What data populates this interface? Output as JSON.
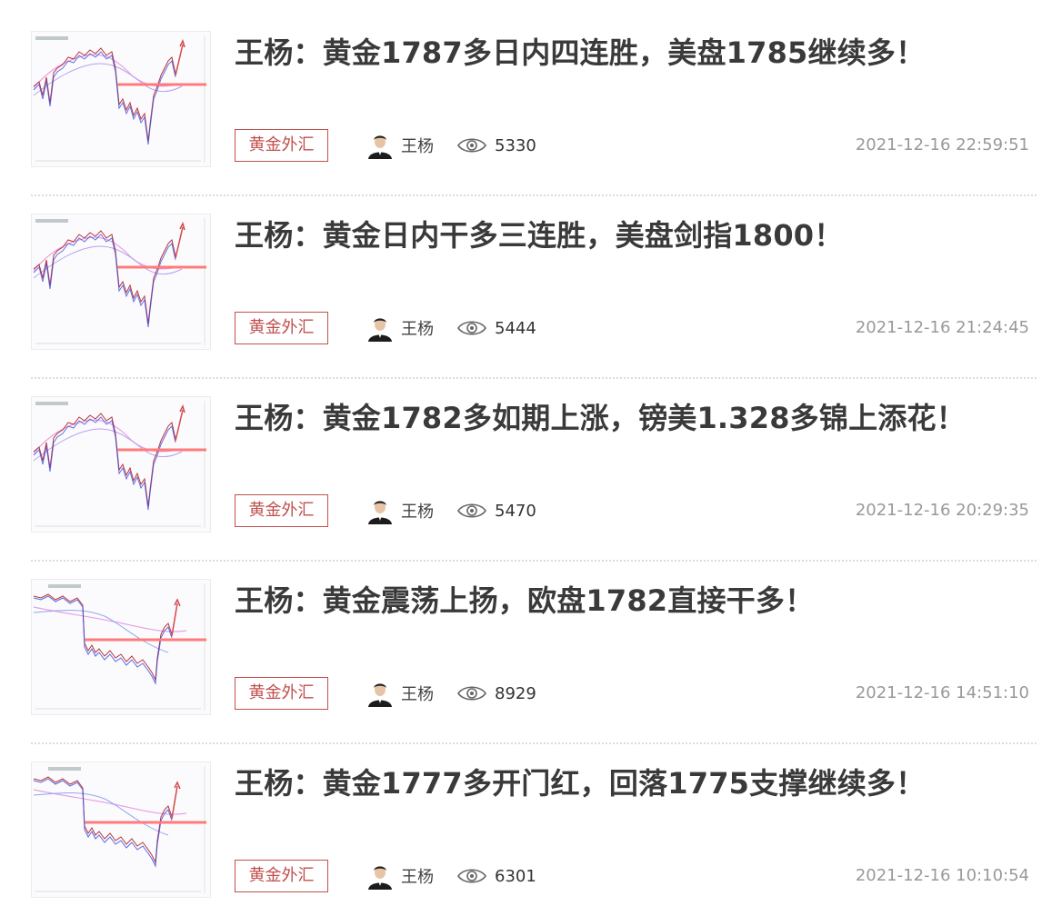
{
  "articles": [
    {
      "title": "王杨：黄金1787多日内四连胜，美盘1785继续多！",
      "tag": "黄金外汇",
      "author": "王杨",
      "views": "5330",
      "time": "2021-12-16 22:59:51",
      "thumb_icon": "gold-price-chart-thumbnail"
    },
    {
      "title": "王杨：黄金日内干多三连胜，美盘剑指1800！",
      "tag": "黄金外汇",
      "author": "王杨",
      "views": "5444",
      "time": "2021-12-16 21:24:45",
      "thumb_icon": "gold-price-chart-thumbnail"
    },
    {
      "title": "王杨：黄金1782多如期上涨，镑美1.328多锦上添花！",
      "tag": "黄金外汇",
      "author": "王杨",
      "views": "5470",
      "time": "2021-12-16 20:29:35",
      "thumb_icon": "gold-price-chart-thumbnail"
    },
    {
      "title": "王杨：黄金震荡上扬，欧盘1782直接干多！",
      "tag": "黄金外汇",
      "author": "王杨",
      "views": "8929",
      "time": "2021-12-16 14:51:10",
      "thumb_icon": "gold-price-chart-thumbnail"
    },
    {
      "title": "王杨：黄金1777多开门红，回落1775支撑继续多！",
      "tag": "黄金外汇",
      "author": "王杨",
      "views": "6301",
      "time": "2021-12-16 10:10:54",
      "thumb_icon": "gold-price-chart-thumbnail"
    }
  ],
  "icons": {
    "views": "eye-icon",
    "author": "avatar-icon"
  },
  "colors": {
    "tag_border": "#c0504d",
    "title": "#3a3a3a",
    "time": "#999999",
    "chart_red_line": "#ff7b7b",
    "chart_magenta": "#e08ae0"
  }
}
